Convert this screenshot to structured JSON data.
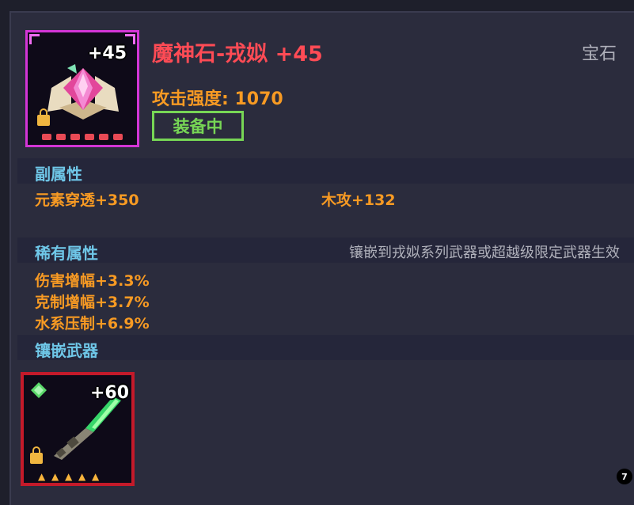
{
  "item": {
    "name": "魔神石-戎姒 +45",
    "category": "宝石",
    "level": "+45",
    "attack": "攻击强度: 1070",
    "equipped": "装备中",
    "icon": "gem-icon",
    "name_color": "#ff4b55"
  },
  "sections": {
    "secondary": {
      "title": "副属性",
      "stats": [
        "元素穿透+350",
        "木攻+132"
      ]
    },
    "rare": {
      "title": "稀有属性",
      "note": "镶嵌到戎姒系列武器或超越级限定武器生效",
      "stats": [
        "伤害增幅+3.3%",
        "克制增幅+3.7%",
        "水系压制+6.9%"
      ]
    },
    "socket": {
      "title": "镶嵌武器",
      "weapon_level": "+60",
      "weapon_icon": "green-spear-icon",
      "star_count": 5
    }
  },
  "page_badge": "7"
}
